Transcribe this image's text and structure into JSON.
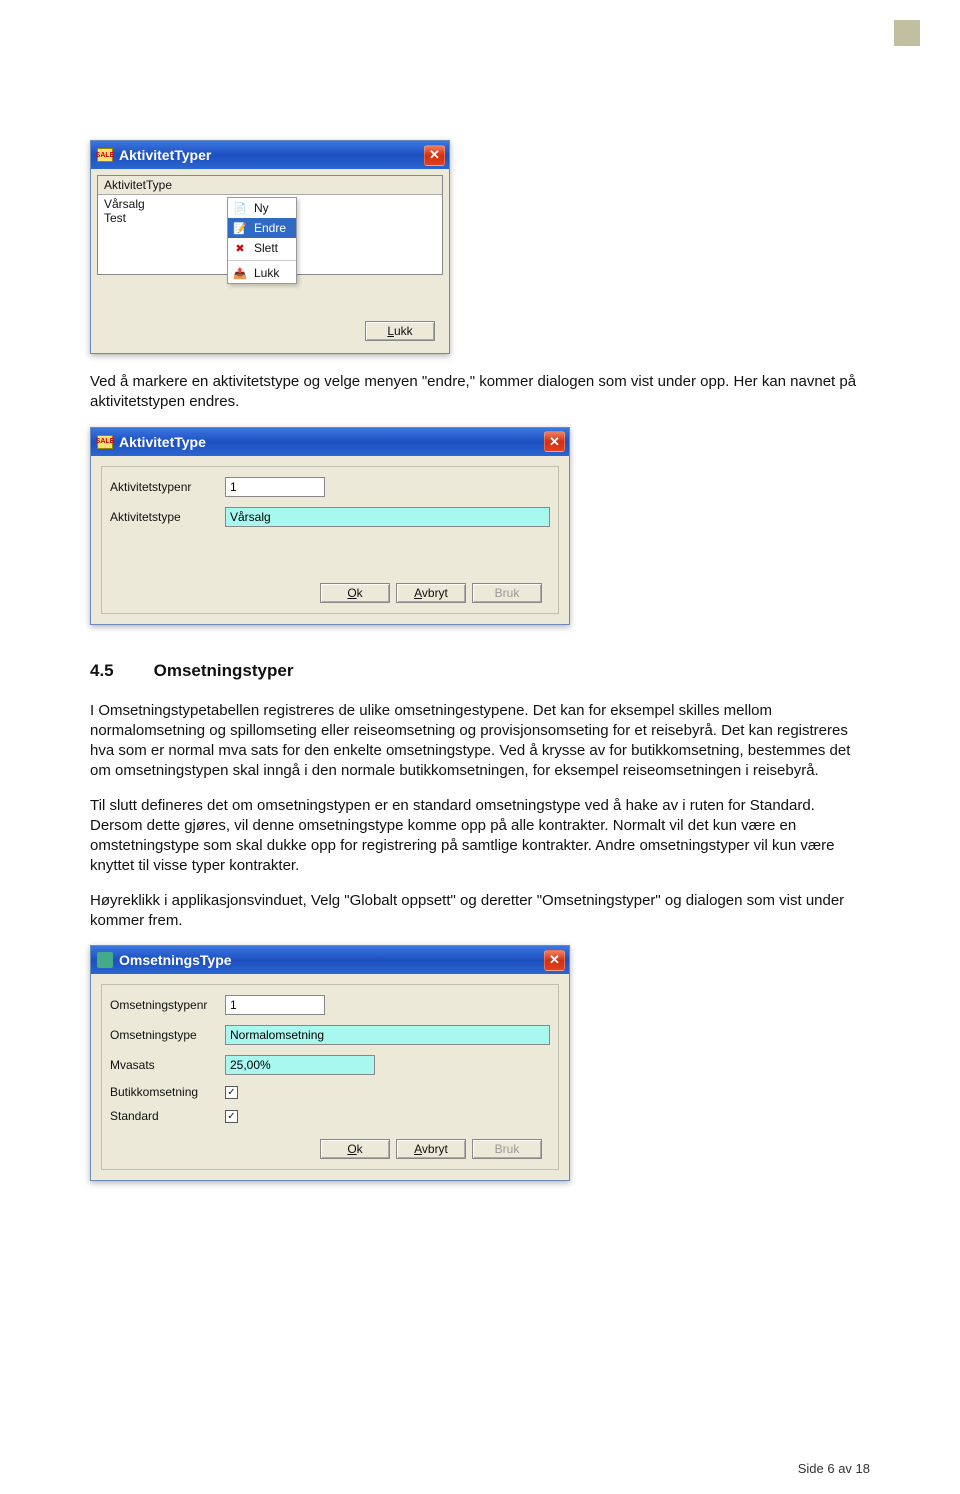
{
  "win1": {
    "title": "AktivitetTyper",
    "list_header": "AktivitetType",
    "list_items": [
      "Vårsalg",
      "Test"
    ],
    "ctx": {
      "ny": "Ny",
      "endre": "Endre",
      "slett": "Slett",
      "lukk": "Lukk"
    },
    "btn_lukk": "Lukk"
  },
  "para1": "Ved å markere en aktivitetstype og velge menyen \"endre,\" kommer dialogen som vist under opp. Her kan navnet på aktivitetstypen endres.",
  "win2": {
    "title": "AktivitetType",
    "label_nr": "Aktivitetstypenr",
    "label_type": "Aktivitetstype",
    "val_nr": "1",
    "val_type": "Vårsalg",
    "btn_ok": "Ok",
    "btn_avbryt": "Avbryt",
    "btn_bruk": "Bruk"
  },
  "section": {
    "num": "4.5",
    "title": "Omsetningstyper"
  },
  "para2": "I Omsetningstypetabellen registreres de ulike omsetningestypene. Det kan for eksempel skilles mellom normalomsetning og spillomseting eller reiseomsetning og provisjonsomseting for et reisebyrå. Det kan registreres hva som er normal mva sats for den enkelte omsetningstype. Ved å krysse av for butikkomsetning, bestemmes det om omsetningstypen skal inngå i den normale butikkomsetningen, for eksempel reiseomsetningen i reisebyrå.",
  "para3": "Til slutt defineres det om omsetningstypen er en standard omsetningstype ved å hake av i ruten for Standard. Dersom dette gjøres, vil denne omsetningstype komme opp på alle kontrakter. Normalt vil det kun være en omstetningstype som skal dukke opp for registrering på samtlige kontrakter. Andre omsetningstyper vil kun være knyttet til visse typer kontrakter.",
  "para4": "Høyreklikk i applikasjonsvinduet, Velg \"Globalt oppsett\" og deretter \"Omsetningstyper\" og dialogen som vist under kommer frem.",
  "win3": {
    "title": "OmsetningsType",
    "label_nr": "Omsetningstypenr",
    "label_type": "Omsetningstype",
    "label_mva": "Mvasats",
    "label_butikk": "Butikkomsetning",
    "label_std": "Standard",
    "val_nr": "1",
    "val_type": "Normalomsetning",
    "val_mva": "25,00%",
    "chk_butikk": true,
    "chk_std": true,
    "btn_ok": "Ok",
    "btn_avbryt": "Avbryt",
    "btn_bruk": "Bruk"
  },
  "footer": "Side 6 av 18"
}
